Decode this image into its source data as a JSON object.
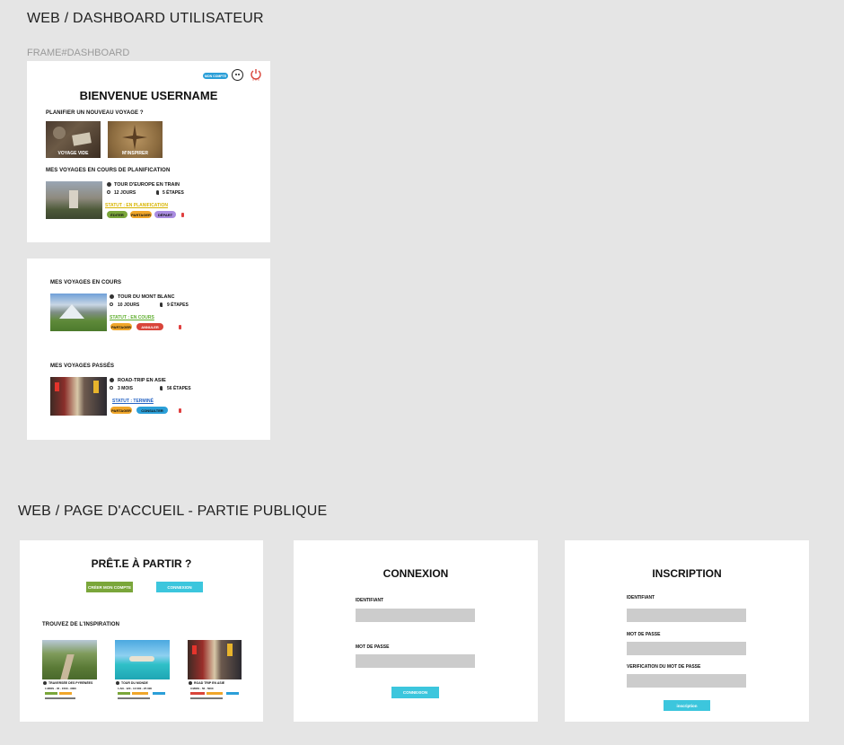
{
  "section_dashboard": {
    "title": "WEB / DASHBOARD UTILISATEUR",
    "frame_label": "FRAME#DASHBOARD"
  },
  "dashboard": {
    "account_button": "MON COMPTE",
    "welcome": "BIENVENUE USERNAME",
    "plan_heading": "PLANIFIER UN NOUVEAU VOYAGE ?",
    "card_empty": "VOYAGE VIDE",
    "card_inspire": "M'INSPIRER",
    "planning_heading": "MES VOYAGES EN COURS DE PLANIFICATION",
    "planning_trip": {
      "title": "TOUR D'EUROPE EN TRAIN",
      "duration": "12 JOURS",
      "steps": "5 ÉTAPES",
      "status": "STATUT : EN PLANIFICATION"
    },
    "planning_actions": [
      "ÉDITER",
      "PARTAGER",
      "DÉPART"
    ],
    "ongoing_heading": "MES VOYAGES EN COURS",
    "ongoing_trip": {
      "title": "TOUR DU MONT BLANC",
      "duration": "10 JOURS",
      "steps": "9 ÉTAPES",
      "status": "STATUT : EN COURS"
    },
    "ongoing_actions": [
      "PARTAGER",
      "ANNULER"
    ],
    "past_heading": "MES VOYAGES PASSÉS",
    "past_trip": {
      "title": "ROAD-TRIP EN ASIE",
      "duration": "3 MOIS",
      "steps": "56 ÉTAPES",
      "status": "STATUT : TERMINÉ"
    },
    "past_actions": [
      "PARTAGER",
      "CONSULTER"
    ]
  },
  "section_public": {
    "title": "WEB / PAGE D'ACCUEIL - PARTIE PUBLIQUE"
  },
  "landing": {
    "headline": "PRÊT.E À PARTIR ?",
    "create_account": "CRÉER MON COMPTE",
    "login": "CONNEXION",
    "inspiration_heading": "TROUVEZ DE L'INSPIRATION",
    "cards": [
      {
        "title": "TRAVERSÉE DES PYRÉNÉES",
        "meta": "1 MOIS · 45 · 1500 - 3000"
      },
      {
        "title": "TOUR DU MONDE",
        "meta": "1 AN · 120 · 10 000 - 25 000"
      },
      {
        "title": "ROAD TRIP EN ASIE",
        "meta": "3 MOIS · 56 · 5000"
      }
    ]
  },
  "login_page": {
    "title": "CONNEXION",
    "id_label": "IDENTIFIANT",
    "password_label": "MOT DE PASSE",
    "submit": "CONNEXION"
  },
  "signup_page": {
    "title": "INSCRIPTION",
    "id_label": "IDENTIFIANT",
    "password_label": "MOT DE PASSE",
    "confirm_label": "VERIFICATION DU MOT DE PASSE",
    "submit": "inscription"
  },
  "colors": {
    "green": "#7aa63a",
    "orange": "#f0a62a",
    "purple": "#a98ce0",
    "red": "#d9453a",
    "blue": "#2b9fd8",
    "cyan": "#3cc6dd",
    "status_yellow": "#d8b400",
    "status_green": "#5fae2e",
    "status_blue": "#2563c4"
  }
}
